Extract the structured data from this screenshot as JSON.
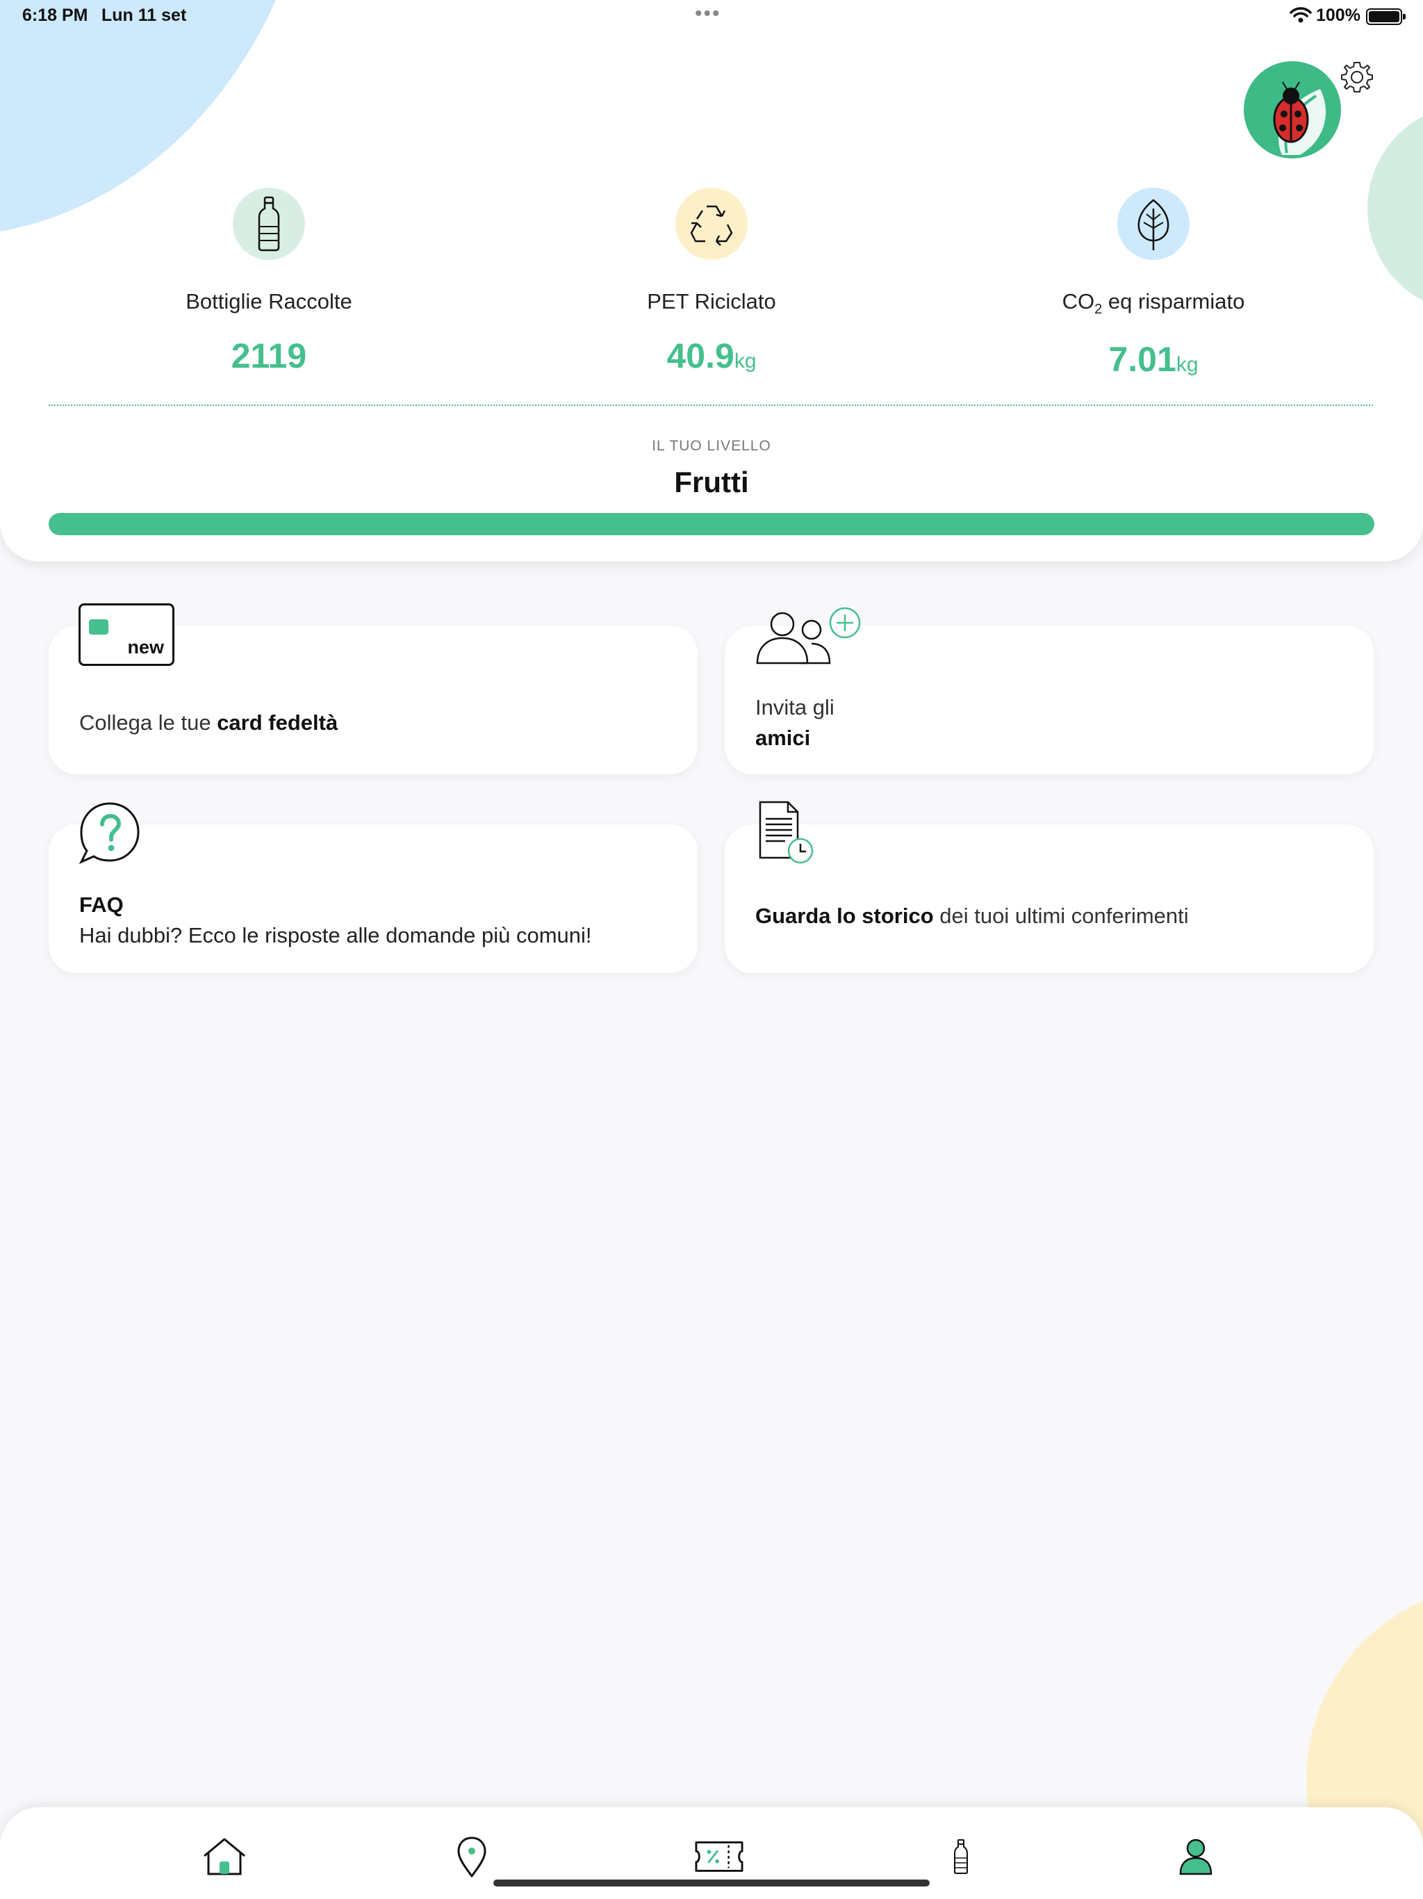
{
  "status_bar": {
    "time": "6:18 PM",
    "date": "Lun 11 set",
    "battery": "100%"
  },
  "colors": {
    "accent": "#45bf8d",
    "bottle_icon_bg": "#d8eee2",
    "recycle_icon_bg": "#fdf0c9",
    "leaf_icon_bg": "#cde9fb"
  },
  "header": {
    "avatar": "ladybug-avatar",
    "settings": "gear-icon"
  },
  "stats": [
    {
      "icon": "bottle-icon",
      "label": "Bottiglie Raccolte",
      "value": "2119",
      "unit": ""
    },
    {
      "icon": "recycle-icon",
      "label": "PET Riciclato",
      "value": "40.9",
      "unit": "kg"
    },
    {
      "icon": "leaf-icon",
      "label_prefix": "CO",
      "label_sub": "2",
      "label_suffix": " eq risparmiato",
      "value": "7.01",
      "unit": "kg"
    }
  ],
  "level": {
    "caption": "IL TUO LIVELLO",
    "name": "Frutti",
    "progress_fraction": 1.0
  },
  "tiles": {
    "card": {
      "icon_badge": "new",
      "text_plain": "Collega le tue ",
      "text_bold": "card fedeltà"
    },
    "invite": {
      "text_plain": "Invita gli",
      "text_bold": "amici"
    },
    "faq": {
      "title": "FAQ",
      "text": "Hai dubbi? Ecco le risposte alle domande più comuni!"
    },
    "history": {
      "text_bold": "Guarda lo storico",
      "text_plain": " dei tuoi ultimi conferimenti"
    }
  },
  "tabbar": [
    {
      "name": "home",
      "icon": "home-icon"
    },
    {
      "name": "map",
      "icon": "map-pin-icon"
    },
    {
      "name": "coupons",
      "icon": "coupon-icon"
    },
    {
      "name": "bottles",
      "icon": "bottle-icon"
    },
    {
      "name": "profile",
      "icon": "profile-icon"
    }
  ]
}
